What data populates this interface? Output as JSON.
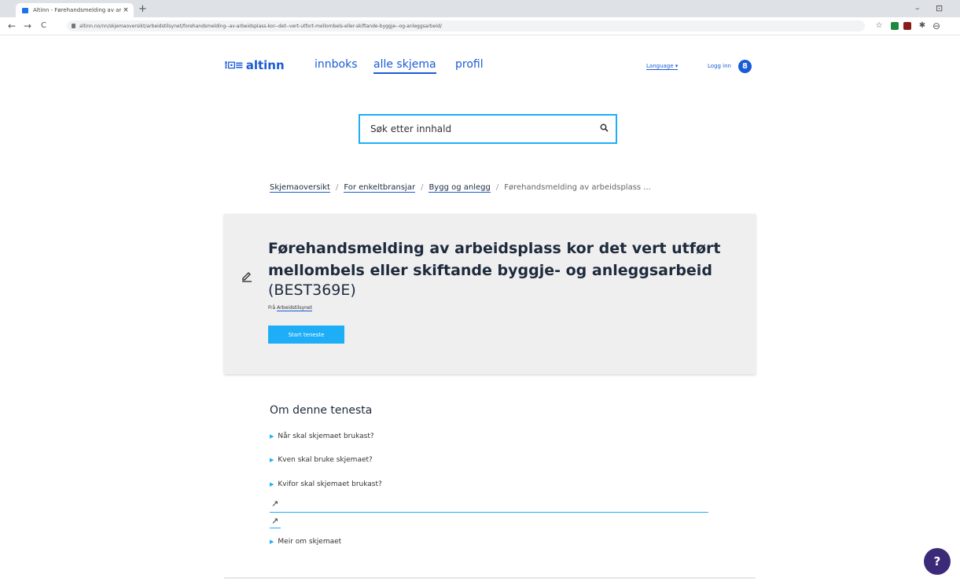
{
  "browser": {
    "tab_title": "Altinn - Førehandsmelding av arb",
    "tab_close": "×",
    "new_tab": "+",
    "url": "altinn.no/nn/skjemaoversikt/arbeidstilsynet/forehandsmelding--av-arbeidsplass-kor--det--vert-utfort-mellombels-eller-skiftande-byggje--og-anleggsarbeid/",
    "back": "←",
    "forward": "→",
    "reload": "C",
    "minimize": "–",
    "restore": "⊡",
    "star": "☆",
    "puzzle": "✱",
    "profile": "⊖"
  },
  "header": {
    "logo_mark": "⁞⊡≡",
    "logo_text": "altinn",
    "nav": [
      "innboks",
      "alle skjema",
      "profil"
    ],
    "language": "Language ▾",
    "login": "Logg inn",
    "login_icon": "8"
  },
  "search": {
    "placeholder": "Søk etter innhald"
  },
  "breadcrumb": {
    "items": [
      "Skjemaoversikt",
      "For enkeltbransjar",
      "Bygg og anlegg"
    ],
    "separator": "/",
    "current": "Førehandsmelding av arbeidsplass ..."
  },
  "service": {
    "title": "Førehandsmelding av arbeidsplass kor det vert utført mellombels eller skiftande byggje- og anleggsarbeid",
    "code": "(BEST369E)",
    "from_prefix": "Frå",
    "agency": "Arbeidstilsynet",
    "start_button": "Start teneste"
  },
  "about": {
    "heading": "Om denne tenesta",
    "items": [
      "Når skal skjemaet brukast?",
      "Kven skal bruke skjemaet?",
      "Kvifor skal skjemaet brukast?",
      "Meir om skjemaet"
    ],
    "arrow": "↗"
  },
  "help": {
    "label": "?"
  }
}
